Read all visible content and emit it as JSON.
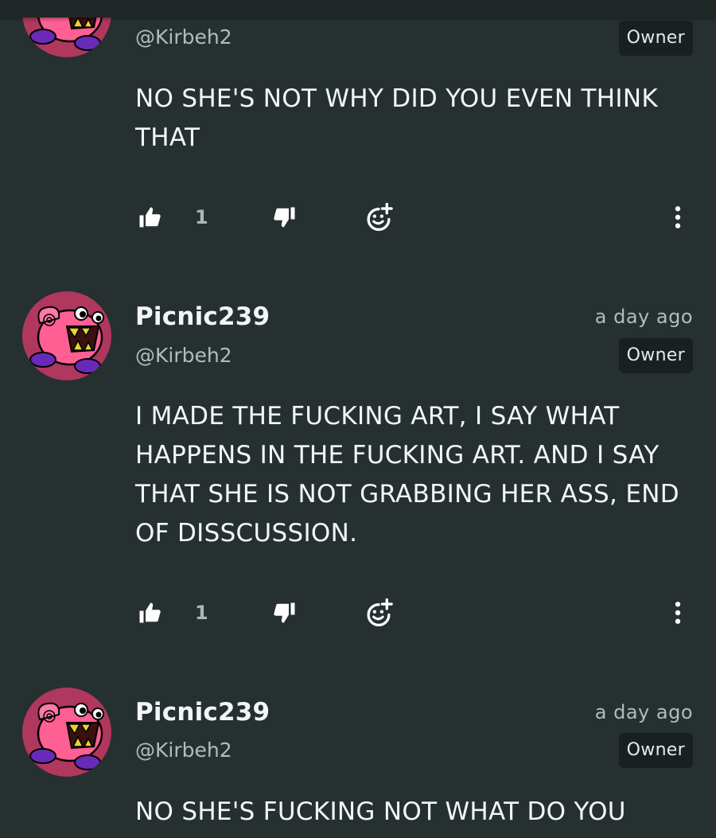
{
  "colors": {
    "background": "#263030",
    "text": "#f4f6f6",
    "muted": "#b3bbbb",
    "badge_bg": "#1a2020",
    "avatar_bg": "#b0375e",
    "avatar_creature": "#ff5f93"
  },
  "icons": {
    "like": "thumbs-up-icon",
    "dislike": "thumbs-down-icon",
    "react": "add-reaction-icon",
    "more": "more-vertical-icon"
  },
  "comments": [
    {
      "handle": "@Kirbeh2",
      "badge": "Owner",
      "text": "NO SHE'S NOT WHY DID YOU EVEN THINK THAT",
      "likes": "1"
    },
    {
      "username": "Picnic239",
      "handle": "@Kirbeh2",
      "time": "a day ago",
      "badge": "Owner",
      "text": "I MADE THE FUCKING ART, I SAY WHAT HAPPENS IN THE FUCKING ART. AND I SAY THAT SHE IS NOT GRABBING HER ASS, END OF DISSCUSSION.",
      "likes": "1"
    },
    {
      "username": "Picnic239",
      "handle": "@Kirbeh2",
      "time": "a day ago",
      "badge": "Owner",
      "text": "NO SHE'S FUCKING NOT WHAT DO YOU"
    }
  ]
}
